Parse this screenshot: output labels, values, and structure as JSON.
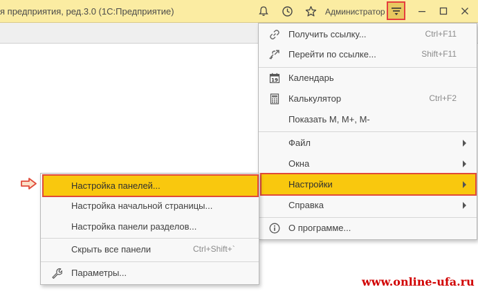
{
  "window": {
    "title": "я предприятия, ред.3.0  (1С:Предприятие)",
    "user": "Администратор"
  },
  "main_menu": {
    "items": [
      {
        "label": "Получить ссылку...",
        "shortcut": "Ctrl+F11",
        "icon": "link-icon"
      },
      {
        "label": "Перейти по ссылке...",
        "shortcut": "Shift+F11",
        "icon": "go-link-icon"
      },
      {
        "label": "Календарь",
        "shortcut": "",
        "icon": "calendar-icon",
        "icon_text": "19"
      },
      {
        "label": "Калькулятор",
        "shortcut": "Ctrl+F2",
        "icon": "calculator-icon"
      },
      {
        "label": "Показать M, M+, M-",
        "shortcut": ""
      },
      {
        "label": "Файл",
        "submenu": true
      },
      {
        "label": "Окна",
        "submenu": true
      },
      {
        "label": "Настройки",
        "submenu": true,
        "highlighted": true
      },
      {
        "label": "Справка",
        "submenu": true
      },
      {
        "label": "О программе...",
        "icon": "info-icon"
      }
    ]
  },
  "settings_submenu": {
    "items": [
      {
        "label": "Настройка панелей...",
        "highlighted": true
      },
      {
        "label": "Настройка начальной страницы..."
      },
      {
        "label": "Настройка панели разделов..."
      },
      {
        "label": "Скрыть все панели",
        "shortcut": "Ctrl+Shift+`"
      },
      {
        "label": "Параметры...",
        "icon": "wrench-icon"
      }
    ]
  },
  "watermark": "www.online-ufa.ru",
  "colors": {
    "titlebar": "#fbeca2",
    "highlight": "#f9c80e",
    "highlight_border": "#e04a3a",
    "watermark": "#d10000"
  }
}
